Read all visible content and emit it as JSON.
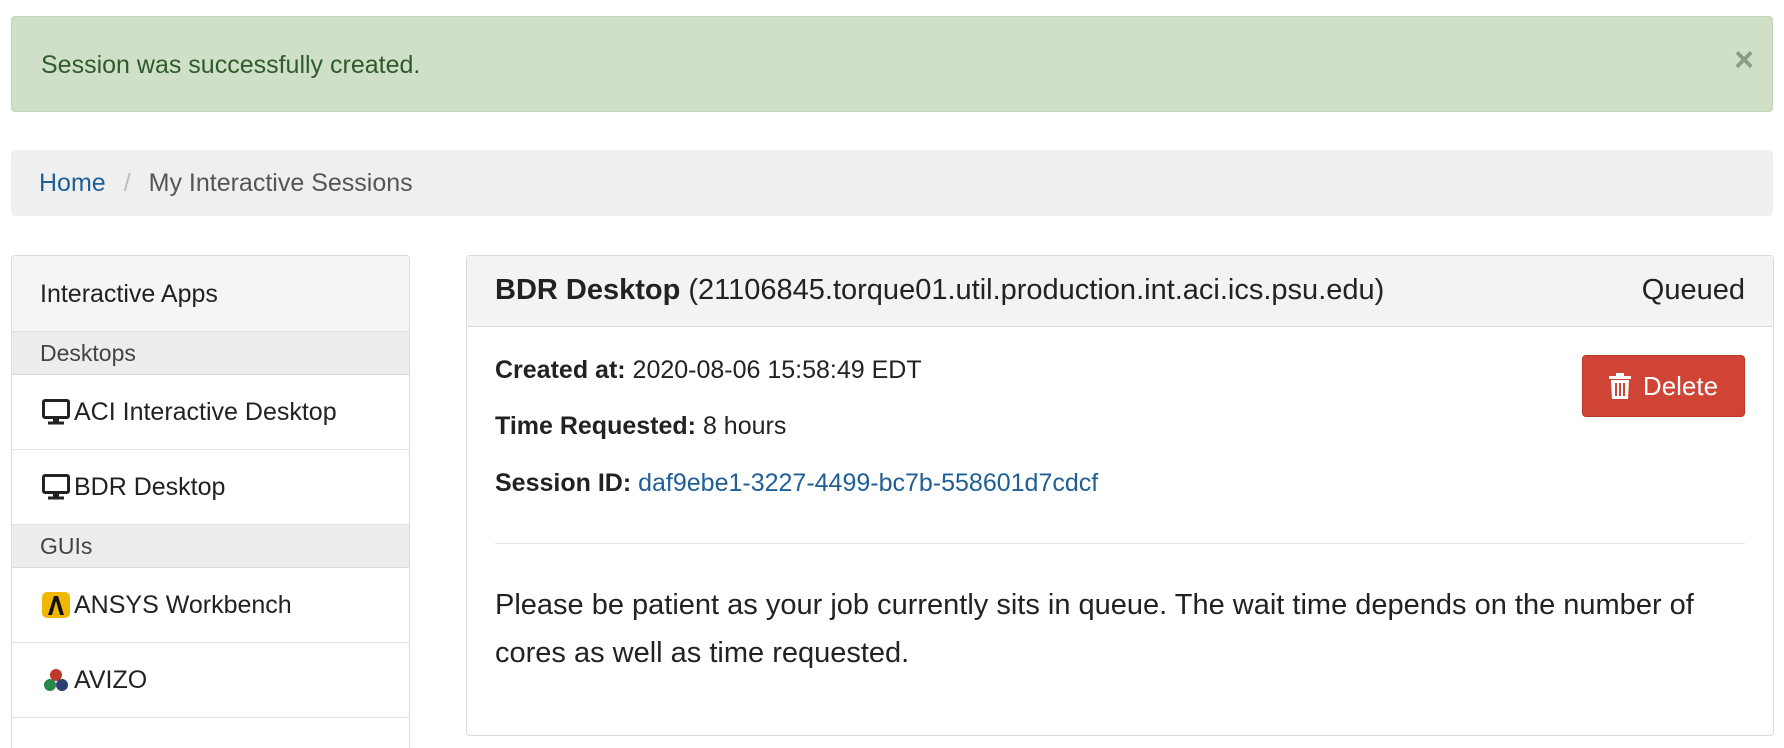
{
  "alert": {
    "message": "Session was successfully created.",
    "close_label": "×"
  },
  "breadcrumb": {
    "home": "Home",
    "separator": "/",
    "current": "My Interactive Sessions"
  },
  "sidebar": {
    "heading": "Interactive Apps",
    "sections": [
      {
        "title": "Desktops",
        "items": [
          {
            "label": "ACI Interactive Desktop",
            "icon": "monitor-icon"
          },
          {
            "label": "BDR Desktop",
            "icon": "monitor-icon"
          }
        ]
      },
      {
        "title": "GUIs",
        "items": [
          {
            "label": "ANSYS Workbench",
            "icon": "ansys-logo-icon"
          },
          {
            "label": "AVIZO",
            "icon": "avizo-logo-icon"
          }
        ]
      }
    ]
  },
  "session": {
    "app_name": "BDR Desktop",
    "job_id": "(21106845.torque01.util.production.int.aci.ics.psu.edu)",
    "status": "Queued",
    "created_label": "Created at:",
    "created_value": "2020-08-06 15:58:49 EDT",
    "time_label": "Time Requested:",
    "time_value": "8 hours",
    "id_label": "Session ID:",
    "id_value": "daf9ebe1-3227-4499-bc7b-558601d7cdcf",
    "delete_label": "Delete",
    "message": "Please be patient as your job currently sits in queue. The wait time depends on the number of cores as well as time requested."
  },
  "colors": {
    "alert_bg": "#d0e0c8",
    "delete_bg": "#cf4434",
    "link": "#1f5f96"
  }
}
